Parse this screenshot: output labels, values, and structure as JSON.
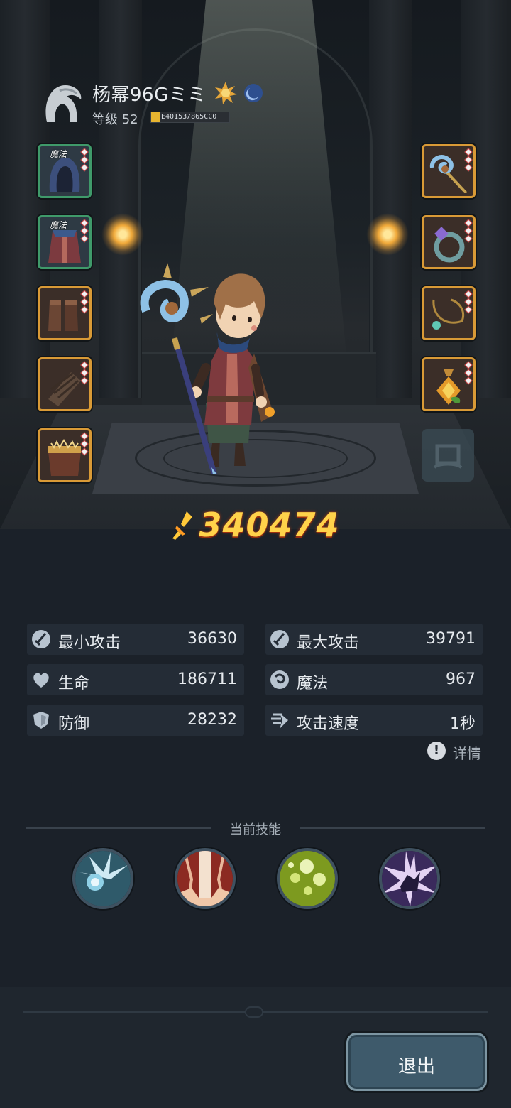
{
  "player": {
    "name": "杨幂96Gミミ",
    "level_label": "等级 52",
    "exp_text": "E40153/865CC0",
    "exp_progress": 0.12
  },
  "equipment": {
    "left": [
      {
        "name": "hood",
        "tag": "魔法",
        "rarity": "green"
      },
      {
        "name": "robe",
        "tag": "魔法",
        "rarity": "green"
      },
      {
        "name": "boots",
        "tag": "",
        "rarity": "orange"
      },
      {
        "name": "bracers",
        "tag": "",
        "rarity": "orange"
      },
      {
        "name": "belt",
        "tag": "",
        "rarity": "orange"
      }
    ],
    "right": [
      {
        "name": "staff",
        "tag": "",
        "rarity": "orange"
      },
      {
        "name": "ring",
        "tag": "",
        "rarity": "orange"
      },
      {
        "name": "necklace",
        "tag": "",
        "rarity": "orange"
      },
      {
        "name": "amulet",
        "tag": "",
        "rarity": "orange"
      }
    ]
  },
  "power": "340474",
  "stats": {
    "min_attack": {
      "label": "最小攻击",
      "value": "36630"
    },
    "max_attack": {
      "label": "最大攻击",
      "value": "39791"
    },
    "life": {
      "label": "生命",
      "value": "186711"
    },
    "magic": {
      "label": "魔法",
      "value": "967"
    },
    "defense": {
      "label": "防御",
      "value": "28232"
    },
    "attack_speed": {
      "label": "攻击速度",
      "value": "1秒"
    }
  },
  "details_label": "详情",
  "skills_title": "当前技能",
  "skills": [
    "ice-orb",
    "fire-pillar",
    "poison-bubbles",
    "shadow-burst"
  ],
  "exit_label": "退出",
  "colors": {
    "background": "#1b2129",
    "stat_panel": "#242c36",
    "power_gold": "#ffd24a",
    "slot_green": "#3f9a6a",
    "slot_orange": "#d99a36",
    "exit_button": "#3e5a6b"
  }
}
